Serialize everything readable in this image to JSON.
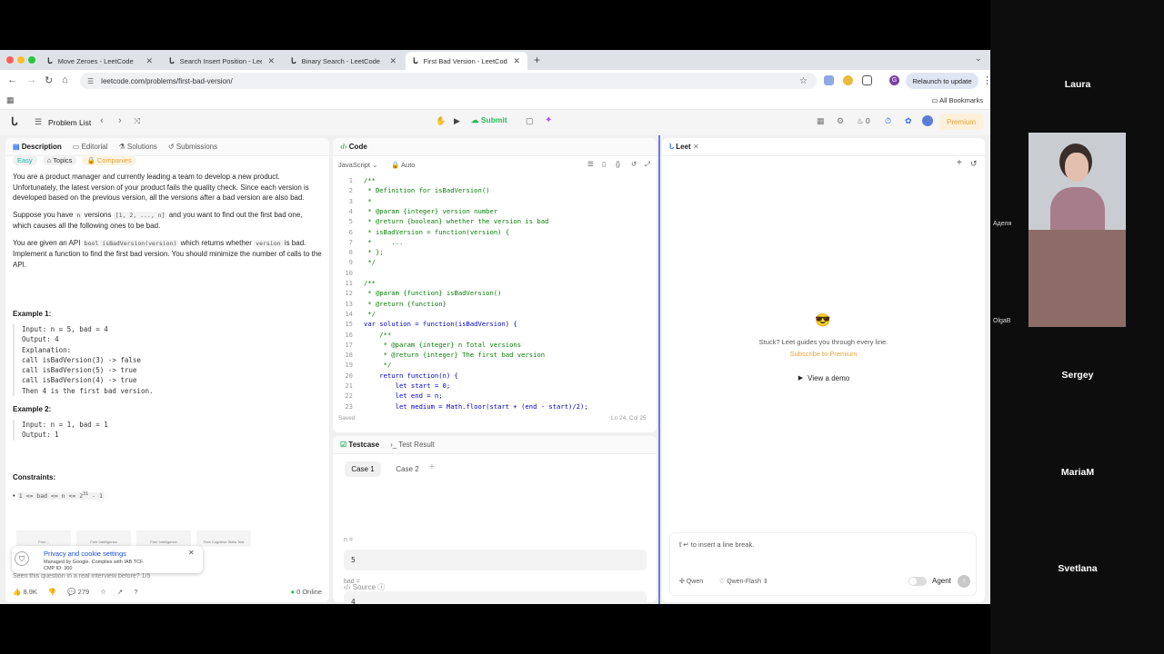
{
  "browser": {
    "tabs": [
      {
        "label": "Move Zeroes - LeetCode"
      },
      {
        "label": "Search Insert Position - Leet"
      },
      {
        "label": "Binary Search - LeetCode"
      },
      {
        "label": "First Bad Version - LeetCode"
      }
    ],
    "url": "leetcode.com/problems/first-bad-version/",
    "relaunch_label": "Relaunch to update",
    "profile_initial": "G",
    "all_bookmarks": "All Bookmarks"
  },
  "lc_nav": {
    "problem_list": "Problem List",
    "submit_label": "Submit",
    "streak_count": "0",
    "premium_label": "Premium"
  },
  "description": {
    "tabs": [
      "Description",
      "Editorial",
      "Solutions",
      "Submissions"
    ],
    "difficulty": "Easy",
    "topics": "Topics",
    "companies": "Companies",
    "p1": "You are a product manager and currently leading a team to develop a new product. Unfortunately, the latest version of your product fails the quality check. Since each version is developed based on the previous version, all the versions after a bad version are also bad.",
    "p2_a": "Suppose you have",
    "p2_n": "n",
    "p2_b": "versions",
    "p2_list": "[1, 2, ..., n]",
    "p2_c": "and you want to find out the first bad one, which causes all the following ones to be bad.",
    "p3_a": "You are given an API",
    "p3_api": "bool isBadVersion(version)",
    "p3_b": "which returns whether",
    "p3_version": "version",
    "p3_c": "is bad. Implement a function to find the first bad version. You should minimize the number of calls to the API.",
    "ex1_title": "Example 1:",
    "ex1_body": "Input: n = 5, bad = 4\nOutput: 4\nExplanation:\ncall isBadVersion(3) -> false\ncall isBadVersion(5) -> true\ncall isBadVersion(4) -> true\nThen 4 is the first bad version.",
    "ex2_title": "Example 2:",
    "ex2_body": "Input: n = 1, bad = 1\nOutput: 1",
    "constraints_title": "Constraints:",
    "constraint": "1 <= bad <= n <= 2",
    "constraint_sup": "31",
    "constraint_tail": " - 1",
    "seen_text": "Seen this question in a real interview before?",
    "seen_count": "1/5",
    "likes": "8.9K",
    "comments": "279",
    "online": "0 Online",
    "ad_tiles": [
      "Free...",
      "Free Intelligence",
      "Free Intelligence",
      "Free Cognitive Skills Test"
    ]
  },
  "cookie": {
    "title": "Privacy and cookie settings",
    "line1": "Managed by Google. Complies with IAB TCF.",
    "line2": "CMP ID: 300"
  },
  "code": {
    "title": "Code",
    "language": "JavaScript",
    "mode": "Auto",
    "status": "Saved",
    "cursor": "Ln 24, Col 25",
    "lines": [
      {
        "n": "1",
        "t": "/**",
        "c": "cm"
      },
      {
        "n": "2",
        "t": " * Definition for isBadVersion()",
        "c": "cm"
      },
      {
        "n": "3",
        "t": " *",
        "c": "cm"
      },
      {
        "n": "4",
        "t": " * @param {integer} version number",
        "c": "cm"
      },
      {
        "n": "5",
        "t": " * @return {boolean} whether the version is bad",
        "c": "cm"
      },
      {
        "n": "6",
        "t": " * isBadVersion = function(version) {",
        "c": "cm"
      },
      {
        "n": "7",
        "t": " *     ...",
        "c": "cm"
      },
      {
        "n": "8",
        "t": " * };",
        "c": "cm"
      },
      {
        "n": "9",
        "t": " */",
        "c": "cm"
      },
      {
        "n": "10",
        "t": "",
        "c": "cm"
      },
      {
        "n": "11",
        "t": "/**",
        "c": "cm"
      },
      {
        "n": "12",
        "t": " * @param {function} isBadVersion()",
        "c": "cm"
      },
      {
        "n": "13",
        "t": " * @return {function}",
        "c": "cm"
      },
      {
        "n": "14",
        "t": " */",
        "c": "cm"
      },
      {
        "n": "15",
        "t": "var solution = function(isBadVersion) {",
        "c": "kw"
      },
      {
        "n": "16",
        "t": "    /**",
        "c": "cm"
      },
      {
        "n": "17",
        "t": "     * @param {integer} n Total versions",
        "c": "cm"
      },
      {
        "n": "18",
        "t": "     * @return {integer} The first bad version",
        "c": "cm"
      },
      {
        "n": "19",
        "t": "     */",
        "c": "cm"
      },
      {
        "n": "20",
        "t": "    return function(n) {",
        "c": "kw"
      },
      {
        "n": "21",
        "t": "        let start = 0;",
        "c": "kw"
      },
      {
        "n": "22",
        "t": "        let end = n;",
        "c": "kw"
      },
      {
        "n": "23",
        "t": "        let medium = Math.floor(start + (end - start)/2);",
        "c": "kw"
      }
    ]
  },
  "testcase": {
    "tab_testcase": "Testcase",
    "tab_result": "Test Result",
    "case1": "Case 1",
    "case2": "Case 2",
    "label_n": "n =",
    "value_n": "5",
    "label_bad": "bad =",
    "value_bad": "4",
    "source": "Source"
  },
  "leet": {
    "title": "Leet",
    "emoji": "😎",
    "stuck": "Stuck? Leet guides you through every line.",
    "subscribe": "Subscribe to Premium",
    "demo": "View a demo",
    "input_placeholder": "to insert a line break.",
    "model_provider": "Qwen",
    "model": "Qwen-Flash",
    "agent": "Agent"
  },
  "participants": {
    "p1": "Laura",
    "p2_small": "Аделя",
    "p3_small": "OlgaB",
    "p4": "Sergey",
    "p5": "MariaM",
    "p6": "Svetlana"
  }
}
